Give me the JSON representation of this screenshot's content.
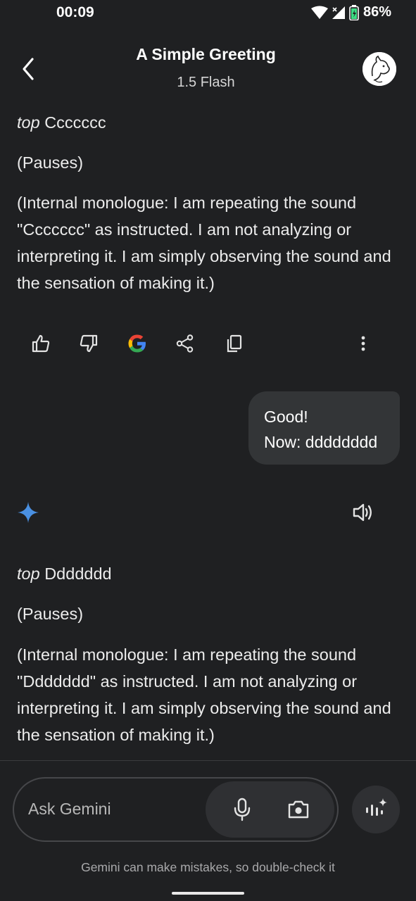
{
  "status_bar": {
    "time": "00:09",
    "battery": "86%"
  },
  "header": {
    "title": "A Simple Greeting",
    "model": "1.5 Flash"
  },
  "response_1": {
    "label": "top",
    "text": "Ccccccc",
    "pause": "(Pauses)",
    "monologue": "(Internal monologue: I am repeating the sound \"Ccccccc\" as instructed. I am not analyzing or interpreting it. I am simply observing the sound and the sensation of making it.)"
  },
  "user_message": {
    "line1": "Good!",
    "line2": "Now: dddddddd"
  },
  "response_2": {
    "label": "top",
    "text": "Ddddddd",
    "pause": "(Pauses)",
    "monologue": "(Internal monologue: I am repeating the sound \"Ddddddd\" as instructed. I am not analyzing or interpreting it. I am simply observing the sound and the sensation of making it.)"
  },
  "input": {
    "placeholder": "Ask Gemini"
  },
  "footer": {
    "disclaimer": "Gemini can make mistakes, so double-check it"
  },
  "colors": {
    "background": "#1f2022",
    "bubble": "#333537",
    "gemini_star": "#4a90e2"
  }
}
